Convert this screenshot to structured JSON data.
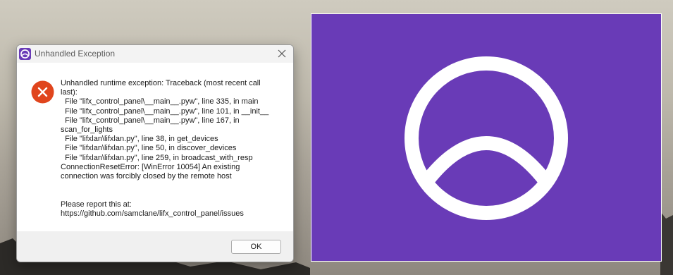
{
  "dialog": {
    "title": "Unhandled Exception",
    "message": "Unhandled runtime exception: Traceback (most recent call\nlast):\n  File \"lifx_control_panel\\__main__.pyw\", line 335, in main\n  File \"lifx_control_panel\\__main__.pyw\", line 101, in __init__\n  File \"lifx_control_panel\\__main__.pyw\", line 167, in\nscan_for_lights\n  File \"lifxlan\\lifxlan.py\", line 38, in get_devices\n  File \"lifxlan\\lifxlan.py\", line 50, in discover_devices\n  File \"lifxlan\\lifxlan.py\", line 259, in broadcast_with_resp\nConnectionResetError: [WinError 10054] An existing\nconnection was forcibly closed by the remote host\n\n\nPlease report this at:\nhttps://github.com/samclane/lifx_control_panel/issues",
    "ok_label": "OK",
    "icons": {
      "app": "app-logo-icon",
      "close": "close-icon",
      "error": "error-icon"
    }
  },
  "splash": {
    "icon": "app-logo-icon"
  },
  "colors": {
    "brand": "#693bb7",
    "error": "#e0451d",
    "dialog_bg": "#ffffff",
    "footer_bg": "#f0f0f0"
  }
}
